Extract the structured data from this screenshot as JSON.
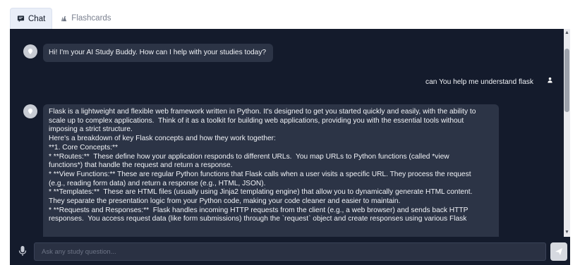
{
  "tabs": [
    {
      "label": "Chat",
      "icon": "chat-icon",
      "active": true
    },
    {
      "label": "Flashcards",
      "icon": "flashcards-icon",
      "active": false
    }
  ],
  "messages": {
    "greeting": "Hi! I'm your AI Study Buddy. How can I help with your studies today?",
    "user": "can You help me understand flask",
    "answer": "Flask is a lightweight and flexible web framework written in Python. It's designed to get you started quickly and easily, with the ability to\nscale up to complex applications.  Think of it as a toolkit for building web applications, providing you with the essential tools without\nimposing a strict structure.\nHere's a breakdown of key Flask concepts and how they work together:\n**1. Core Concepts:**\n* **Routes:**  These define how your application responds to different URLs.  You map URLs to Python functions (called *view\nfunctions*) that handle the request and return a response.\n* **View Functions:** These are regular Python functions that Flask calls when a user visits a specific URL. They process the request\n(e.g., reading form data) and return a response (e.g., HTML, JSON).\n* **Templates:**  These are HTML files (usually using Jinja2 templating engine) that allow you to dynamically generate HTML content.\nThey separate the presentation logic from your Python code, making your code cleaner and easier to maintain.\n* **Requests and Responses:**  Flask handles incoming HTTP requests from the client (e.g., a web browser) and sends back HTTP\nresponses.  You access request data (like form submissions) through the `request` object and create responses using various Flask"
  },
  "input": {
    "placeholder": "Ask any study question..."
  },
  "colors": {
    "chat_bg": "#141b2c",
    "bubble_bg": "#2c3446",
    "tab_active_bg": "#e9eef8"
  }
}
